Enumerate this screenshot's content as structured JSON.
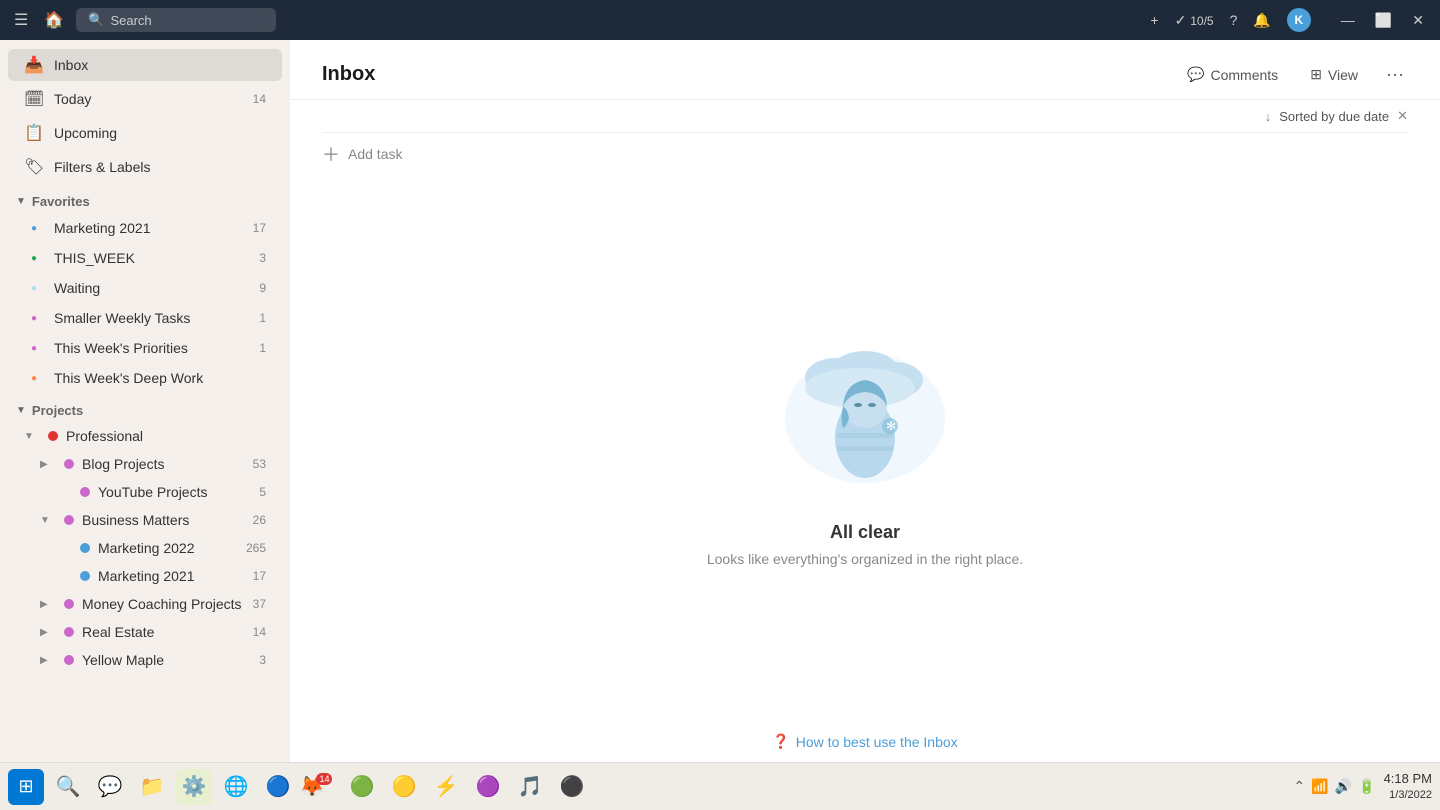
{
  "titlebar": {
    "search_placeholder": "Search",
    "today_count": "10/5",
    "avatar_letter": "K"
  },
  "sidebar": {
    "nav_items": [
      {
        "id": "inbox",
        "label": "Inbox",
        "icon": "📥",
        "count": null,
        "active": true
      },
      {
        "id": "today",
        "label": "Today",
        "icon": "📅",
        "count": "14"
      },
      {
        "id": "upcoming",
        "label": "Upcoming",
        "icon": "🗓",
        "count": null
      },
      {
        "id": "filters",
        "label": "Filters & Labels",
        "icon": "🔲",
        "count": null
      }
    ],
    "favorites_header": "Favorites",
    "favorites": [
      {
        "label": "Marketing 2021",
        "color": "#4a9eda",
        "count": "17"
      },
      {
        "label": "THIS_WEEK",
        "color": "#22aa55",
        "count": "3"
      },
      {
        "label": "Waiting",
        "color": "#aaddee",
        "count": "9"
      },
      {
        "label": "Smaller Weekly Tasks",
        "color": "#cc66cc",
        "count": "1"
      },
      {
        "label": "This Week's Priorities",
        "color": "#cc66cc",
        "count": "1"
      },
      {
        "label": "This Week's Deep Work",
        "color": "#ff8844",
        "count": null
      }
    ],
    "projects_header": "Projects",
    "projects": [
      {
        "label": "Professional",
        "color": "#e03535",
        "indent": 0,
        "expandable": true,
        "expanded": true,
        "count": null
      },
      {
        "label": "Blog Projects",
        "color": "#cc66cc",
        "indent": 1,
        "expandable": true,
        "count": "53"
      },
      {
        "label": "YouTube Projects",
        "color": "#cc66cc",
        "indent": 2,
        "expandable": false,
        "count": "5"
      },
      {
        "label": "Business Matters",
        "color": "#cc66cc",
        "indent": 1,
        "expandable": true,
        "expanded": true,
        "count": "26"
      },
      {
        "label": "Marketing 2022",
        "color": "#4a9eda",
        "indent": 2,
        "expandable": false,
        "count": "265"
      },
      {
        "label": "Marketing 2021",
        "color": "#4a9eda",
        "indent": 2,
        "expandable": false,
        "count": "17"
      },
      {
        "label": "Money Coaching Projects",
        "color": "#cc66cc",
        "indent": 1,
        "expandable": true,
        "count": "37"
      },
      {
        "label": "Real Estate",
        "color": "#cc66cc",
        "indent": 1,
        "expandable": true,
        "count": "14"
      },
      {
        "label": "Yellow Maple",
        "color": "#cc66cc",
        "indent": 1,
        "expandable": true,
        "count": "3"
      }
    ]
  },
  "main": {
    "title": "Inbox",
    "comments_label": "Comments",
    "view_label": "View",
    "sort_label": "Sorted by due date",
    "add_task_label": "Add task",
    "empty_title": "All clear",
    "empty_subtitle": "Looks like everything's organized in the right place.",
    "help_link": "How to best use the Inbox"
  },
  "taskbar": {
    "time": "4:18 PM",
    "date": "1/3/2022",
    "app_icons": [
      "⊞",
      "🔍",
      "💬",
      "📁",
      "⚙️",
      "🌐",
      "🔵",
      "🔴",
      "🟢",
      "🟡",
      "⚡",
      "🟣",
      "🎵",
      "⚫"
    ]
  }
}
